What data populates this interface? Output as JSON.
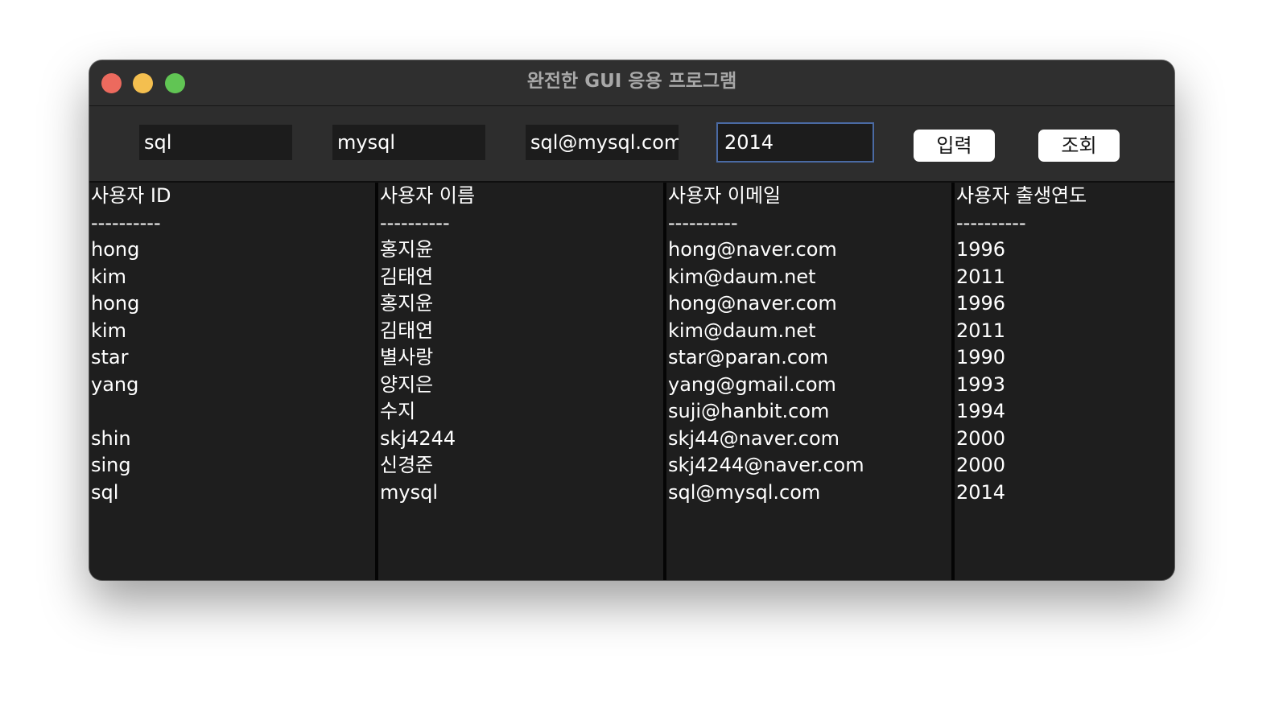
{
  "window": {
    "title": "완전한 GUI 응용 프로그램"
  },
  "inputs": {
    "user_id": "sql",
    "user_name": "mysql",
    "user_email": "sql@mysql.com",
    "birth_year": "2014"
  },
  "buttons": {
    "insert_label": "입력",
    "select_label": "조회"
  },
  "columns": [
    {
      "header": "사용자 ID",
      "separator": "----------",
      "values": [
        "hong",
        "kim",
        "hong",
        "kim",
        "star",
        "yang",
        "",
        "shin",
        "sing",
        "sql"
      ]
    },
    {
      "header": "사용자 이름",
      "separator": "----------",
      "values": [
        "홍지윤",
        "김태연",
        "홍지윤",
        "김태연",
        "별사랑",
        "양지은",
        "수지",
        "skj4244",
        "신경준",
        "mysql"
      ]
    },
    {
      "header": "사용자 이메일",
      "separator": "----------",
      "values": [
        "hong@naver.com",
        "kim@daum.net",
        "hong@naver.com",
        "kim@daum.net",
        "star@paran.com",
        "yang@gmail.com",
        "suji@hanbit.com",
        "skj44@naver.com",
        "skj4244@naver.com",
        "sql@mysql.com"
      ]
    },
    {
      "header": "사용자 출생연도",
      "separator": "----------",
      "values": [
        "1996",
        "2011",
        "1996",
        "2011",
        "1990",
        "1993",
        "1994",
        "2000",
        "2000",
        "2014"
      ]
    }
  ],
  "colors": {
    "window_bg": "#1e1e1e",
    "titlebar_bg": "#2f2f2f",
    "toolbar_bg": "#2d2d2d",
    "focus_ring": "#4a6aa3",
    "close": "#ec6a5e",
    "minimize": "#f4bf4f",
    "zoom": "#61c554"
  }
}
